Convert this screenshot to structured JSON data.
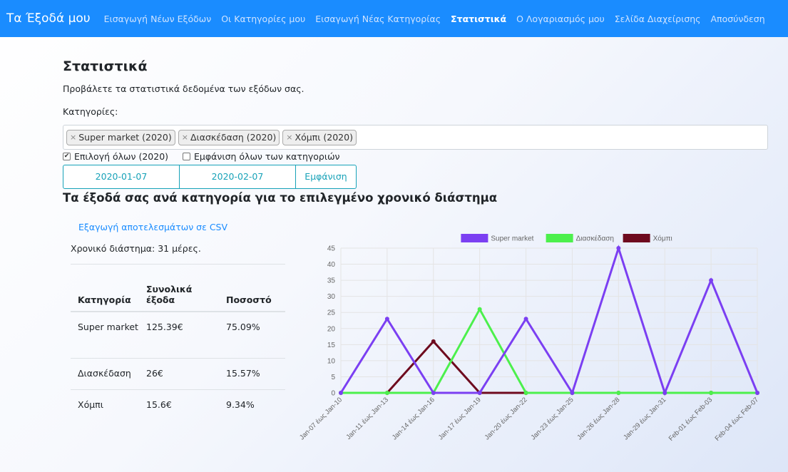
{
  "navbar": {
    "brand": "Τα Έξοδά μου",
    "items": [
      {
        "label": "Εισαγωγή Νέων Εξόδων",
        "active": false
      },
      {
        "label": "Οι Κατηγορίες μου",
        "active": false
      },
      {
        "label": "Εισαγωγή Νέας Κατηγορίας",
        "active": false
      },
      {
        "label": "Στατιστικά",
        "active": true
      },
      {
        "label": "Ο Λογαριασμός μου",
        "active": false
      },
      {
        "label": "Σελίδα Διαχείρισης",
        "active": false
      },
      {
        "label": "Αποσύνδεση",
        "active": false
      }
    ]
  },
  "page": {
    "title": "Στατιστικά",
    "subtitle": "Προβάλετε τα στατιστικά δεδομένα των εξόδων σας.",
    "categories_label": "Κατηγορίες:"
  },
  "tags": [
    "Super market (2020)",
    "Διασκέδαση (2020)",
    "Χόμπι (2020)"
  ],
  "checkboxes": [
    {
      "label": "Επιλογή όλων (2020)",
      "checked": true
    },
    {
      "label": "Εμφάνιση όλων των κατηγοριών",
      "checked": false
    }
  ],
  "dates": {
    "from": "2020-01-07",
    "to": "2020-02-07",
    "show_label": "Εμφάνιση"
  },
  "results": {
    "title": "Τα έξοδά σας ανά κατηγορία για το επιλεγμένο χρονικό διάστημα",
    "csv_link": "Εξαγωγή αποτελεσμάτων σε CSV",
    "period": "Χρονικό διάστημα: 31 μέρες."
  },
  "table": {
    "headers": [
      "Κατηγορία",
      "Συνολικά έξοδα",
      "Ποσοστό"
    ],
    "rows": [
      {
        "category": "Super market",
        "total": "125.39€",
        "percent": "75.09%"
      },
      {
        "category": "Διασκέδαση",
        "total": "26€",
        "percent": "15.57%"
      },
      {
        "category": "Χόμπι",
        "total": "15.6€",
        "percent": "9.34%"
      }
    ]
  },
  "colors": {
    "navbar": "#1a8cff",
    "link": "#1a8cff",
    "info": "#17a2b8"
  },
  "chart_data": {
    "type": "line",
    "categories": [
      "Jan-07 έως Jan-10",
      "Jan-11 έως Jan-13",
      "Jan-14 έως Jan-16",
      "Jan-17 έως Jan-19",
      "Jan-20 έως Jan-22",
      "Jan-23 έως Jan-25",
      "Jan-26 έως Jan-28",
      "Jan-29 έως Jan-31",
      "Feb-01 έως Feb-03",
      "Feb-04 έως Feb-07"
    ],
    "series": [
      {
        "name": "Super market",
        "color": "#7b3ff2",
        "values": [
          0,
          23,
          0,
          0,
          23,
          0,
          45,
          0,
          35,
          0
        ]
      },
      {
        "name": "Διασκέδαση",
        "color": "#4cf04c",
        "values": [
          0,
          0,
          0,
          26,
          0,
          0,
          0,
          0,
          0,
          0
        ]
      },
      {
        "name": "Χόμπι",
        "color": "#6e0a1e",
        "values": [
          0,
          0,
          16,
          0,
          0,
          0,
          0,
          0,
          0,
          0
        ]
      }
    ],
    "yticks": [
      0,
      5,
      10,
      15,
      20,
      25,
      30,
      35,
      40,
      45
    ],
    "ylim": [
      0,
      45
    ],
    "grid": true,
    "legend": "top"
  }
}
